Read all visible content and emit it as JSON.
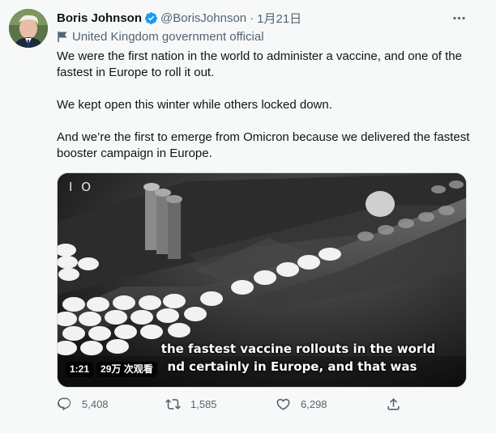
{
  "tweet": {
    "display_name": "Boris Johnson",
    "handle": "@BorisJohnson",
    "separator": "·",
    "date": "1月21日",
    "label": "United Kingdom government official",
    "paragraphs": [
      "We were the first nation in the world to administer a vaccine, and one of the fastest in Europe to roll it out.",
      "We kept open this winter while others locked down.",
      "And we’re the first to emerge from Omicron because we delivered the fastest booster campaign in Europe."
    ]
  },
  "video": {
    "channel_logo": "I O",
    "subtitle_line1": "the fastest vaccine rollouts in the world",
    "subtitle_line2": "nd certainly in Europe, and that was",
    "duration": "1:21",
    "views": "29万 次观看"
  },
  "actions": {
    "reply_count": "5,408",
    "retweet_count": "1,585",
    "like_count": "6,298"
  },
  "colors": {
    "background": "#f7f9f9",
    "text": "#0f1419",
    "secondary": "#536471",
    "verified": "#1d9bf0"
  },
  "icons": {
    "verified": "verified-badge-icon",
    "more": "more-options-icon",
    "flag": "flag-icon",
    "reply": "reply-icon",
    "retweet": "retweet-icon",
    "like": "heart-icon",
    "share": "share-icon"
  }
}
